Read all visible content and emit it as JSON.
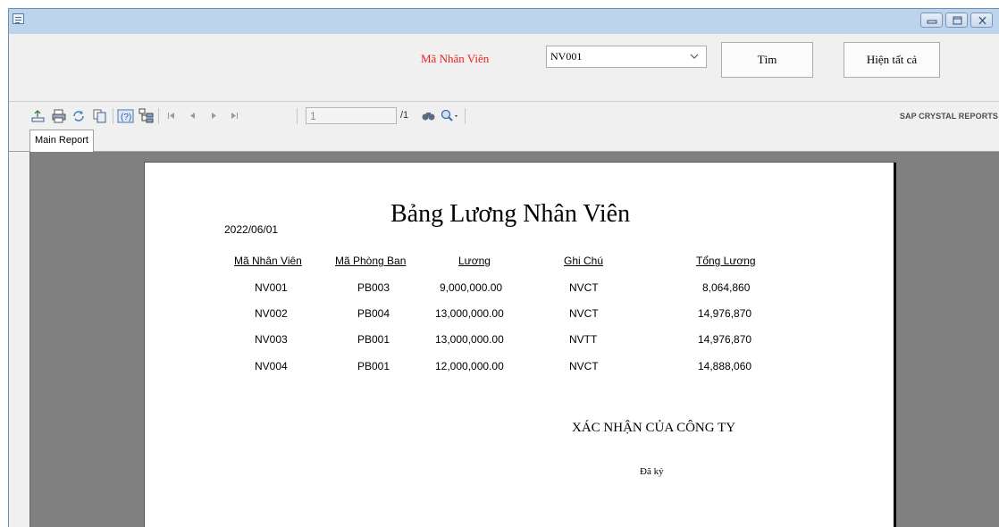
{
  "window": {
    "controls": [
      "minimize-icon",
      "maximize-icon",
      "close-icon"
    ]
  },
  "search": {
    "label": "Mã Nhân Viên",
    "label_color": "#e82020",
    "selected": "NV001",
    "find_button": "Tìm",
    "show_all_button": "Hiện tất cả"
  },
  "viewer": {
    "toolbar_icons": [
      "export-icon",
      "print-icon",
      "refresh-icon",
      "copy-icon",
      "help-icon",
      "group-tree-icon",
      "first-page-icon",
      "prev-page-icon",
      "next-page-icon",
      "last-page-icon",
      "find-icon",
      "zoom-icon"
    ],
    "page_current": "1",
    "page_total": "/1",
    "brand": "SAP CRYSTAL REPORTS",
    "tab": "Main Report"
  },
  "report": {
    "date": "2022/06/01",
    "title": "Bảng Lương Nhân Viên",
    "columns": [
      "Mã Nhân Viên",
      "Mã Phòng Ban",
      "Lương",
      "Ghi Chú",
      "Tổng Lương"
    ],
    "rows": [
      [
        "NV001",
        "PB003",
        "9,000,000.00",
        "NVCT",
        "8,064,860"
      ],
      [
        "NV002",
        "PB004",
        "13,000,000.00",
        "NVCT",
        "14,976,870"
      ],
      [
        "NV003",
        "PB001",
        "13,000,000.00",
        "NVTT",
        "14,976,870"
      ],
      [
        "NV004",
        "PB001",
        "12,000,000.00",
        "NVCT",
        "14,888,060"
      ]
    ],
    "confirm": "XÁC NHẬN CỦA CÔNG TY",
    "signed": "Đã ký"
  }
}
